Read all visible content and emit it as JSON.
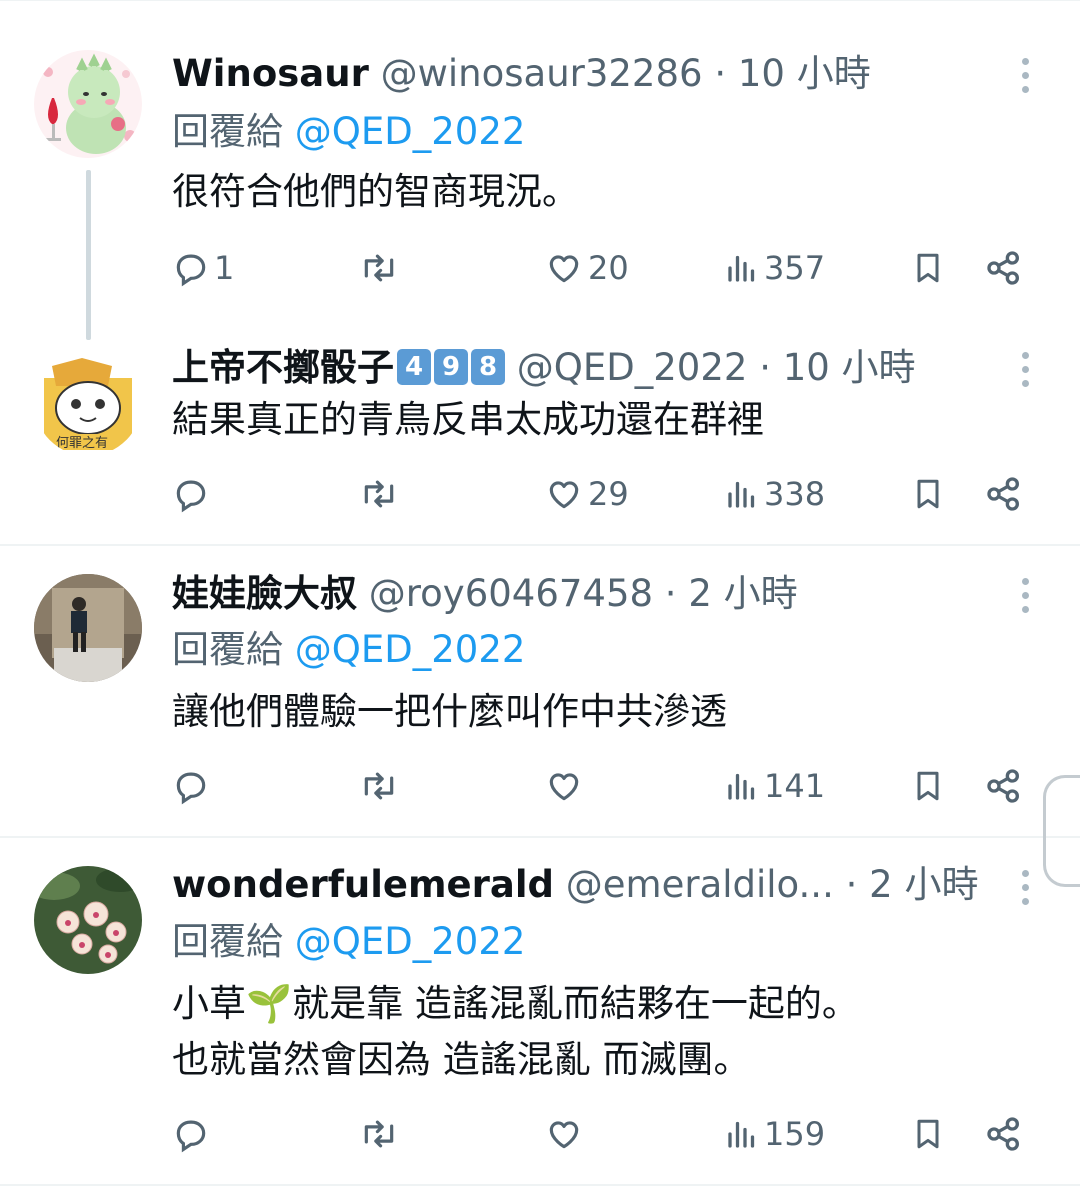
{
  "posts": [
    {
      "name": "Winosaur",
      "handle": "@winosaur32286",
      "separator": "·",
      "time": "10 小時",
      "reply_prefix": "回覆給",
      "reply_to": "@QED_2022",
      "text_lines": [
        "很符合他們的智商現況。"
      ],
      "reply_count": "1",
      "like_count": "20",
      "view_count": "357",
      "avatar": "dinosaur-avatar"
    },
    {
      "name": "上帝不擲骰子",
      "name_emoji": [
        "4",
        "9",
        "8"
      ],
      "handle": "@QED_2022",
      "separator": "·",
      "time": "10 小時",
      "text_lines": [
        "結果真正的青鳥反串太成功還在群裡"
      ],
      "reply_count": "",
      "like_count": "29",
      "view_count": "338",
      "avatar": "cartoon-avatar"
    },
    {
      "name": "娃娃臉大叔",
      "handle": "@roy60467458",
      "separator": "·",
      "time": "2 小時",
      "reply_prefix": "回覆給",
      "reply_to": "@QED_2022",
      "text_lines": [
        "讓他們體驗一把什麼叫作中共滲透"
      ],
      "reply_count": "",
      "like_count": "",
      "view_count": "141",
      "avatar": "person-photo-avatar"
    },
    {
      "name": "wonderfulemerald",
      "handle": "@emeraldilo...",
      "separator": "·",
      "time": "2 小時",
      "reply_prefix": "回覆給",
      "reply_to": "@QED_2022",
      "text_lines": [
        "小草🌱就是靠 造謠混亂而結夥在一起的。",
        "也就當然會因為 造謠混亂 而滅團。"
      ],
      "reply_count": "",
      "like_count": "",
      "view_count": "159",
      "avatar": "orchid-avatar"
    }
  ],
  "colors": {
    "primary_text": "#0f1419",
    "secondary_text": "#536471",
    "link": "#1d9bf0",
    "divider": "#eff3f4"
  },
  "icons": [
    "reply-icon",
    "retweet-icon",
    "like-icon",
    "views-icon",
    "bookmark-icon",
    "share-icon",
    "more-icon"
  ]
}
